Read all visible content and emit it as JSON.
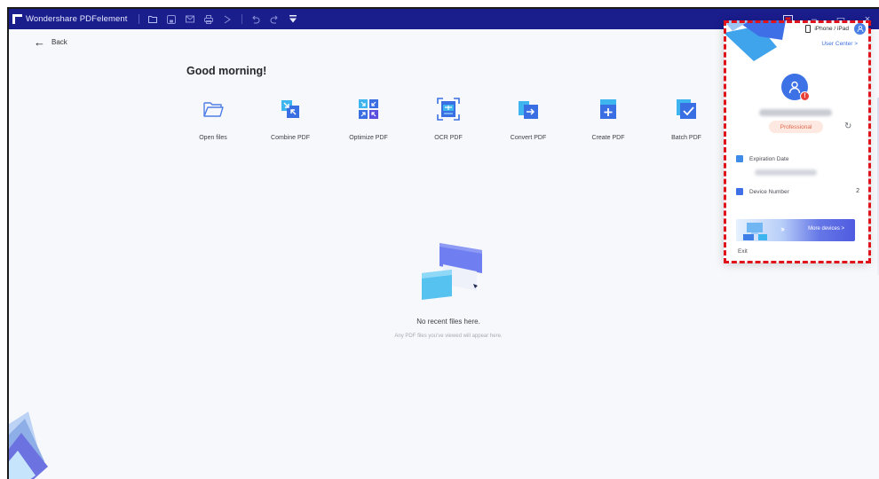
{
  "titlebar": {
    "app_title": "Wondershare PDFelement",
    "toolbar_icons": [
      "folder-icon",
      "save-icon",
      "mail-icon",
      "print-icon",
      "share-icon",
      "undo-icon",
      "redo-icon",
      "customize-icon"
    ],
    "window_buttons": {
      "minimize": "–",
      "maximize": "▭",
      "close": "×"
    },
    "accent": "#1a1d8c"
  },
  "nav": {
    "back_label": "Back",
    "back_arrow": "←"
  },
  "home": {
    "greeting": "Good morning!",
    "actions": [
      {
        "label": "Open files",
        "icon": "folder-open-icon"
      },
      {
        "label": "Combine PDF",
        "icon": "combine-icon"
      },
      {
        "label": "Optimize PDF",
        "icon": "optimize-icon"
      },
      {
        "label": "OCR PDF",
        "icon": "ocr-icon"
      },
      {
        "label": "Convert PDF",
        "icon": "convert-icon"
      },
      {
        "label": "Create PDF",
        "icon": "create-icon"
      },
      {
        "label": "Batch PDF",
        "icon": "batch-icon"
      }
    ],
    "empty_title": "No recent files here.",
    "empty_subtitle": "Any PDF files you've viewed will appear here."
  },
  "account_popover": {
    "device_link": "iPhone / iPad",
    "user_center": "User Center >",
    "plan": "Professional",
    "expiration_label": "Expiration Date",
    "device_number_label": "Device Number",
    "device_number_value": "2",
    "more_devices": "More devices >",
    "exit": "Exit",
    "highlight_color": "#e0131a"
  }
}
